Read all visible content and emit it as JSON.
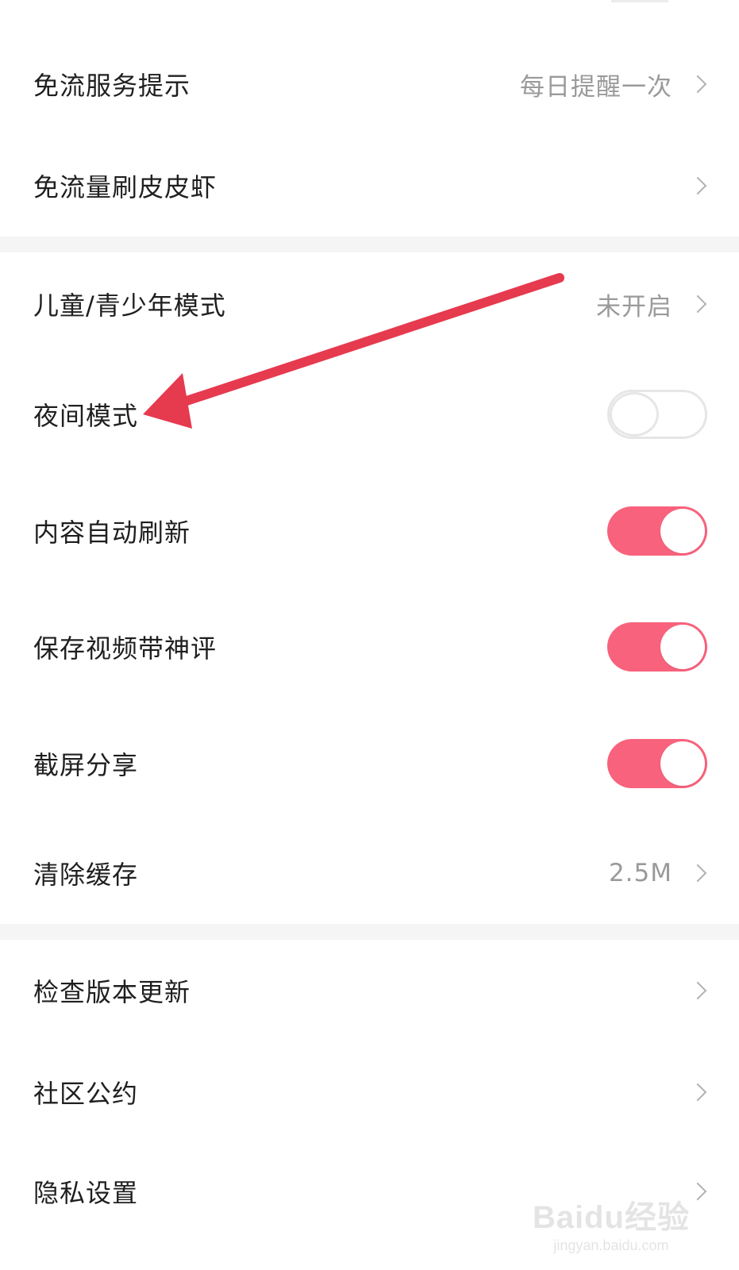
{
  "settings": {
    "free_flow_tip": {
      "label": "免流服务提示",
      "value": "每日提醒一次"
    },
    "free_flow_browse": {
      "label": "免流量刷皮皮虾"
    },
    "teen_mode": {
      "label": "儿童/青少年模式",
      "value": "未开启"
    },
    "night_mode": {
      "label": "夜间模式",
      "enabled": false
    },
    "auto_refresh": {
      "label": "内容自动刷新",
      "enabled": true
    },
    "save_video_comment": {
      "label": "保存视频带神评",
      "enabled": true
    },
    "screenshot_share": {
      "label": "截屏分享",
      "enabled": true
    },
    "clear_cache": {
      "label": "清除缓存",
      "value": "2.5M"
    },
    "check_update": {
      "label": "检查版本更新"
    },
    "community_rules": {
      "label": "社区公约"
    },
    "privacy": {
      "label": "隐私设置"
    }
  },
  "colors": {
    "toggle_on": "#f8627c",
    "arrow": "#e63a4f",
    "section_gap": "#f5f5f5"
  },
  "watermark": {
    "logo": "Baidu经验",
    "site": "jingyan.baidu.com"
  }
}
